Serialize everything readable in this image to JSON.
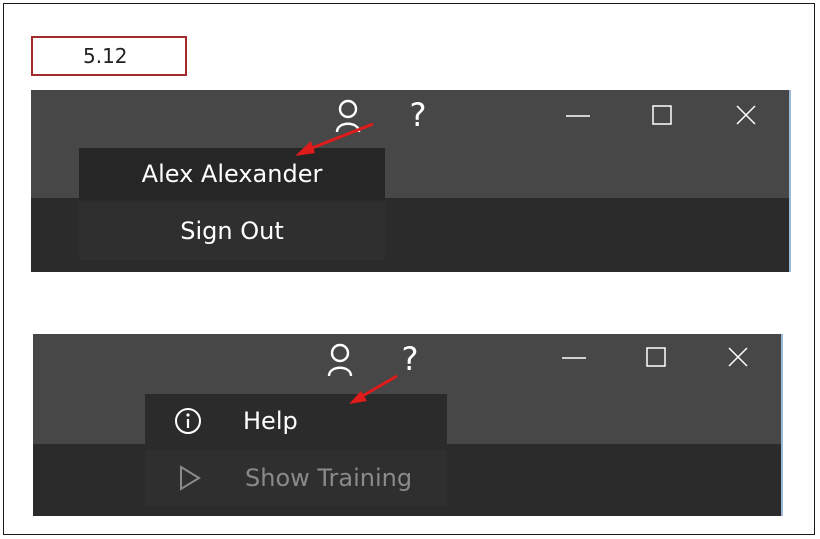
{
  "figure_label": "5.12",
  "panel_account": {
    "account_icon": "person-icon",
    "help_icon": "question-mark-icon",
    "window_controls": [
      "minimize-icon",
      "maximize-icon",
      "close-icon"
    ],
    "menu_items": [
      {
        "label": "Alex Alexander"
      },
      {
        "label": "Sign Out"
      }
    ]
  },
  "panel_help": {
    "account_icon": "person-icon",
    "help_icon": "question-mark-icon",
    "window_controls": [
      "minimize-icon",
      "maximize-icon",
      "close-icon"
    ],
    "menu_items": [
      {
        "label": "Help",
        "icon": "info-circle-icon"
      },
      {
        "label": "Show Training",
        "icon": "play-outline-icon",
        "disabled": true
      }
    ]
  },
  "colors": {
    "title_bar": "#474747",
    "menu_background": "#2b2b2b",
    "annotation_arrow": "#e01b1b",
    "label_border": "#a52a2a"
  }
}
